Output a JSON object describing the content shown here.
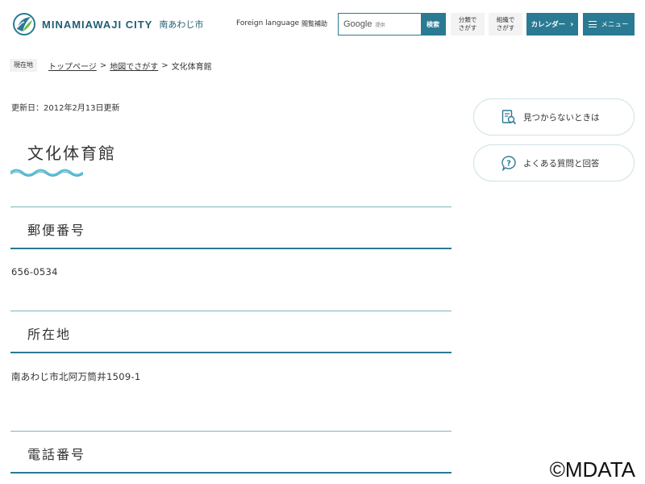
{
  "header": {
    "logo_en": "MINAMIAWAJI CITY",
    "logo_ja": "南あわじ市",
    "foreign_language": "Foreign language",
    "browse_assist": "閲覧補助",
    "search": {
      "brand": "Google",
      "provided": "提供",
      "button": "検索"
    },
    "by_category": [
      "分類で",
      "さがす"
    ],
    "by_organization": [
      "組織で",
      "さがす"
    ],
    "calendar": "カレンダー",
    "menu": "メニュー"
  },
  "breadcrumb": {
    "label": "現在地",
    "items": [
      "トップページ",
      "地図でさがす",
      "文化体育館"
    ]
  },
  "updated": "更新日：2012年2月13日更新",
  "page_title": "文化体育館",
  "sidebar": {
    "not_found": "見つからないときは",
    "faq": "よくある質問と回答"
  },
  "sections": [
    {
      "heading": "郵便番号",
      "value": "656-0534"
    },
    {
      "heading": "所在地",
      "value": "南あわじ市北阿万筒井1509-1"
    },
    {
      "heading": "電話番号",
      "value": ""
    }
  ],
  "watermark": "©MDATA",
  "colors": {
    "accent": "#2a7a93",
    "logo": "#1f5e74",
    "line": "#7fb3c0"
  }
}
